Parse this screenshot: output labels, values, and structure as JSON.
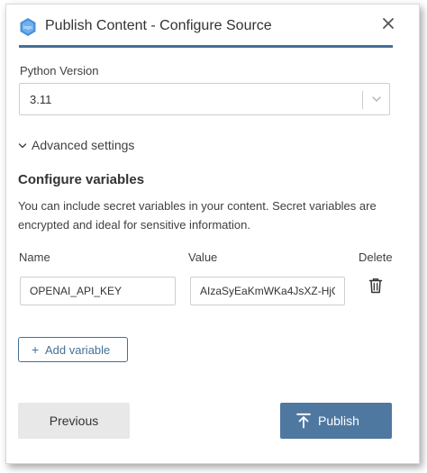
{
  "colors": {
    "accent": "#447099",
    "publish_button_bg": "#4f78a1",
    "previous_button_bg": "#e8e8e8",
    "border": "#cfcfcf",
    "text": "#333333"
  },
  "dialog": {
    "title": "Publish Content - Configure Source",
    "logo_icon": "rstudio-connect-logo-icon",
    "close_icon": "close-icon"
  },
  "python": {
    "label": "Python Version",
    "selected_value": "3.11",
    "dropdown_icon": "chevron-down-icon"
  },
  "advanced": {
    "label": "Advanced settings",
    "icon": "chevron-down-icon"
  },
  "variables": {
    "title": "Configure variables",
    "description": "You can include secret variables in your content. Secret variables are encrypted and ideal for sensitive information.",
    "columns": {
      "name": "Name",
      "value": "Value",
      "delete": "Delete"
    },
    "rows": [
      {
        "name": "OPENAI_API_KEY",
        "value": "AIzaSyEaKmWKa4JsXZ-HjGʻ",
        "delete_icon": "trash-icon"
      }
    ],
    "add_button": {
      "icon": "plus-icon",
      "label": "Add variable"
    }
  },
  "footer": {
    "previous_label": "Previous",
    "publish_label": "Publish",
    "publish_icon": "upload-icon"
  }
}
